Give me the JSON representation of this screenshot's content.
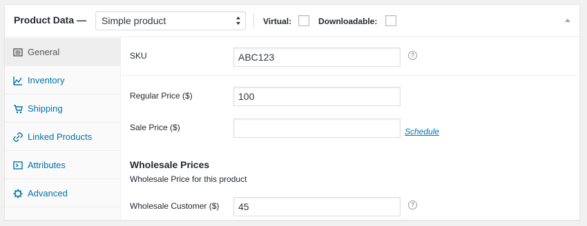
{
  "header": {
    "title": "Product Data —",
    "product_type": "Simple product",
    "virtual_label": "Virtual:",
    "downloadable_label": "Downloadable:"
  },
  "tabs": [
    {
      "label": "General",
      "icon": "general-icon",
      "active": true
    },
    {
      "label": "Inventory",
      "icon": "inventory-icon",
      "active": false
    },
    {
      "label": "Shipping",
      "icon": "shipping-icon",
      "active": false
    },
    {
      "label": "Linked Products",
      "icon": "linked-products-icon",
      "active": false
    },
    {
      "label": "Attributes",
      "icon": "attributes-icon",
      "active": false
    },
    {
      "label": "Advanced",
      "icon": "advanced-icon",
      "active": false
    }
  ],
  "fields": {
    "sku": {
      "label": "SKU",
      "value": "ABC123"
    },
    "regular_price": {
      "label": "Regular Price ($)",
      "value": "100"
    },
    "sale_price": {
      "label": "Sale Price ($)",
      "value": ""
    },
    "schedule_link": "Schedule"
  },
  "wholesale": {
    "title": "Wholesale Prices",
    "description": "Wholesale Price for this product",
    "customer_label": "Wholesale Customer ($)",
    "customer_value": "45"
  },
  "colors": {
    "link": "#0073aa",
    "active_tab_bg": "#eeeeee",
    "border": "#eeeeee"
  }
}
